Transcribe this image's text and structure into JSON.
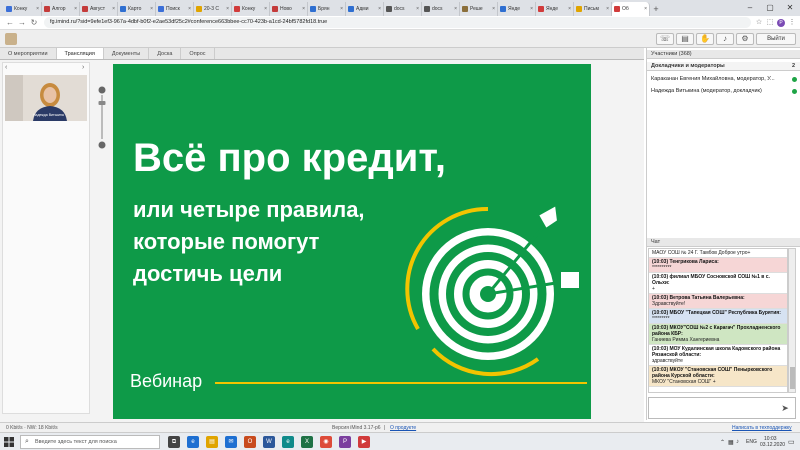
{
  "browser": {
    "tabs": [
      {
        "label": "Конку",
        "color": "#3b6fd8"
      },
      {
        "label": "Алгор",
        "color": "#c43b3b"
      },
      {
        "label": "Август",
        "color": "#c43b3b"
      },
      {
        "label": "Карто",
        "color": "#2f6fd1"
      },
      {
        "label": "Поиск",
        "color": "#3b6fd8"
      },
      {
        "label": "20-3 С",
        "color": "#e0a400"
      },
      {
        "label": "Конку",
        "color": "#d13b3b"
      },
      {
        "label": "Ново",
        "color": "#c43b3b"
      },
      {
        "label": "Брян",
        "color": "#2f6fd1"
      },
      {
        "label": "Адми",
        "color": "#2f6fd1"
      },
      {
        "label": "docs",
        "color": "#555555"
      },
      {
        "label": "docs",
        "color": "#555555"
      },
      {
        "label": "Реше",
        "color": "#8b6f3b"
      },
      {
        "label": "Янде",
        "color": "#2f6fd1"
      },
      {
        "label": "Янде",
        "color": "#d13b3b"
      },
      {
        "label": "Письм",
        "color": "#e0a400"
      },
      {
        "label": "Об",
        "color": "#d13b3b",
        "active": true
      }
    ],
    "new_tab": "+",
    "url": "fg.imind.ru/?sid=9efe1ef3-967a-4dbf-b0f2-e2ae53df25c2#conference663bbee-cc70-423b-a1cd-24bf5782fd18.true",
    "profile_initial": "Р"
  },
  "app": {
    "exit_label": "Выйти",
    "tabs": [
      {
        "label": "О мероприятии"
      },
      {
        "label": "Трансляция",
        "active": true
      },
      {
        "label": "Документы"
      },
      {
        "label": "Доска"
      },
      {
        "label": "Опрос"
      }
    ],
    "camera_caption": "Надежда Витькина",
    "status_left": "0 Kbit/s  ·  NW: 18 Kbit/s",
    "version": "Версия iMind 3.17-p6",
    "version_sep": "|",
    "version_link": "О продукте",
    "tech_support": "Написать в техподдержку"
  },
  "slide": {
    "title": "Всё про кредит,",
    "line2": "или четыре правила,",
    "line3": "которые помогут",
    "line4": "достичь цели",
    "webinar": "Вебинар",
    "green": "#0e9a48",
    "yellow": "#f2c400"
  },
  "participants": {
    "header": "Участники (368)",
    "group": "Докладчики и модераторы",
    "group_count": "2",
    "members": [
      {
        "name": "Караканан Евгения Михайловна, модератор, У..."
      },
      {
        "name": "Надежда Витькина (модератор, докладчик)"
      }
    ]
  },
  "chat": {
    "header": "Чат",
    "messages": [
      {
        "who": "",
        "text": "МАОУ СОШ № 24 Г. Тамбов Доброе утро+",
        "bg": "#ffffff"
      },
      {
        "who": "(10:03) Тенгрикова Лариса:",
        "text": "**********",
        "bg": "#f6d6d6"
      },
      {
        "who": "(10:03) филиал МБОУ Сосновской СОШ №1 в с. Ольхи:",
        "text": "+",
        "bg": "#ffffff"
      },
      {
        "who": "(10:03) Ветрова Татьяна Валерьевна:",
        "text": "Здравствуйте!",
        "bg": "#f6d6d6"
      },
      {
        "who": "(10:03) МБОУ \"Тапецкая СОШ\" Республика Бурятия:",
        "text": "*********",
        "bg": "#d6e2f2"
      },
      {
        "who": "(10:03) МКОУ\"СОШ №2 с Карагач\" Прохладненского района КБР:",
        "text": "Ганиева Римма Хангериевна",
        "bg": "#cfe6c2"
      },
      {
        "who": "(10:03) МОУ Кудалинская школа Кадомского района Рязанской области:",
        "text": "здравствуйте",
        "bg": "#ffffff"
      },
      {
        "who": "(10:03) МКОУ \"Становская СОШ\" Пенырковского района Курской области:",
        "text": "МКОУ \"Становская СОШ\" +",
        "bg": "#f6e6c8"
      }
    ],
    "send_icon": "➤"
  },
  "taskbar": {
    "search_placeholder": "Введите здесь текст для поиска",
    "apps": [
      {
        "glyph": "⧉",
        "color": "#444444"
      },
      {
        "glyph": "e",
        "color": "#1e6fd1"
      },
      {
        "glyph": "▤",
        "color": "#e0a400"
      },
      {
        "glyph": "✉",
        "color": "#1e6fd1"
      },
      {
        "glyph": "O",
        "color": "#c84b1e"
      },
      {
        "glyph": "W",
        "color": "#2b579a"
      },
      {
        "glyph": "e",
        "color": "#0f8a8a"
      },
      {
        "glyph": "X",
        "color": "#1e7145"
      },
      {
        "glyph": "◉",
        "color": "#dd4b39"
      },
      {
        "glyph": "P",
        "color": "#7b3f9e"
      },
      {
        "glyph": "▶",
        "color": "#d13b3b"
      }
    ],
    "lang": "ENG",
    "time": "10:03",
    "date": "03.12.2020"
  }
}
